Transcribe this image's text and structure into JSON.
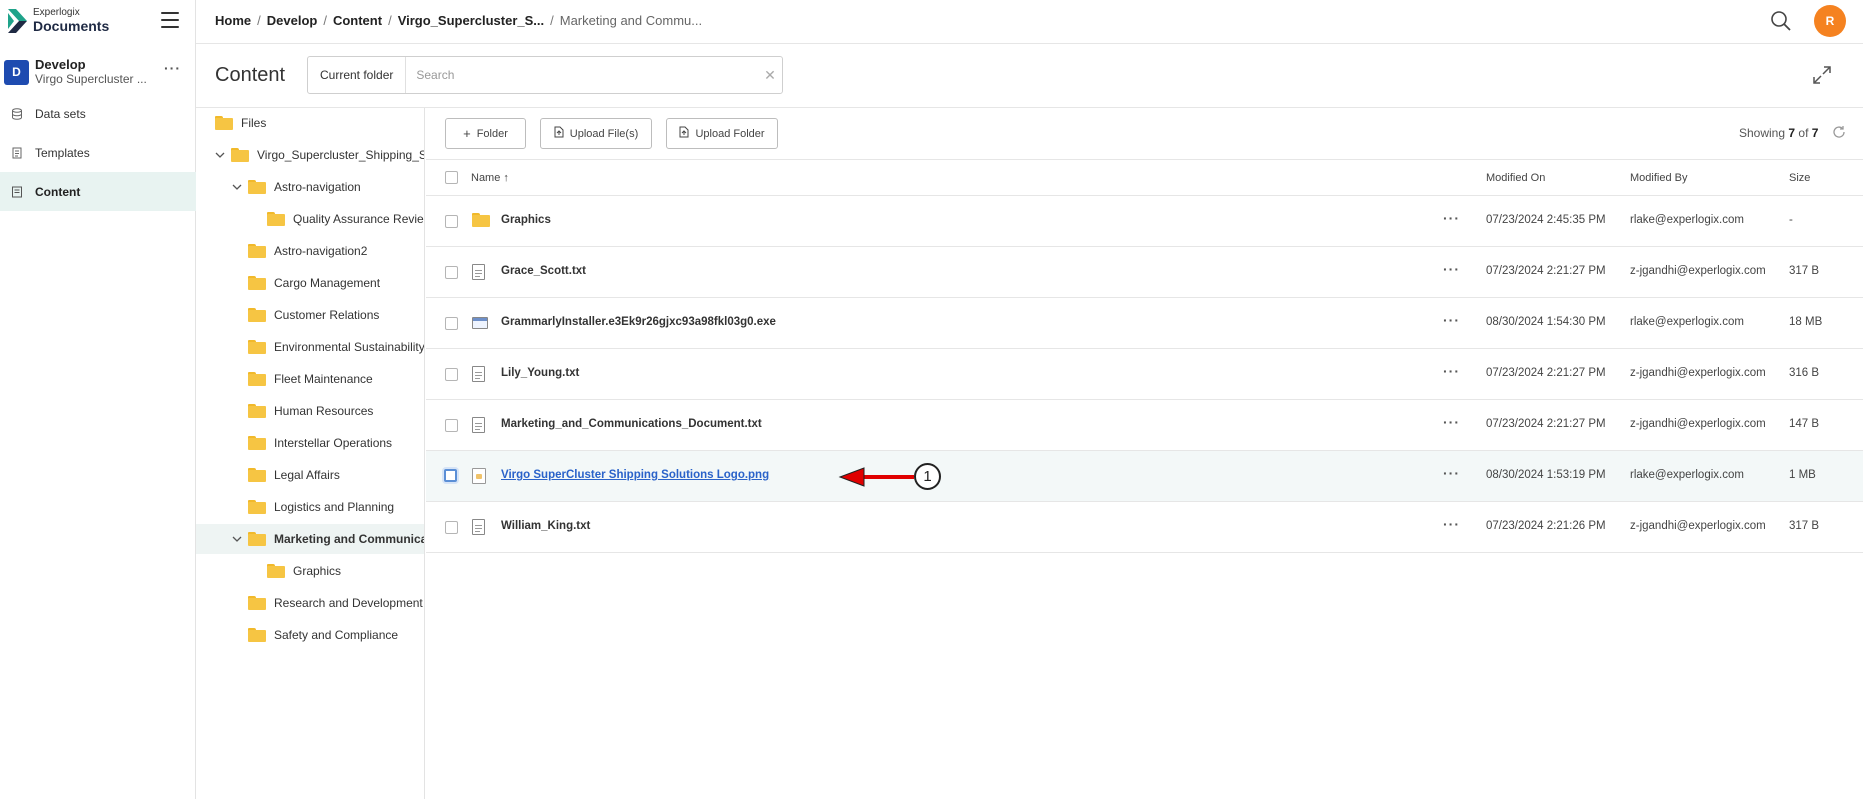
{
  "brand": {
    "small": "Experlogix",
    "big": "Documents"
  },
  "workspace": {
    "initial": "D",
    "title": "Develop",
    "subtitle": "Virgo Supercluster ..."
  },
  "nav": [
    {
      "label": "Data sets",
      "icon": "database-icon"
    },
    {
      "label": "Templates",
      "icon": "template-icon"
    },
    {
      "label": "Content",
      "icon": "content-icon",
      "active": true
    }
  ],
  "breadcrumb": {
    "items": [
      "Home",
      "Develop",
      "Content",
      "Virgo_Supercluster_S..."
    ],
    "current": "Marketing and Commu..."
  },
  "user": {
    "initial": "R",
    "color": "#f58220"
  },
  "content_header": {
    "title": "Content",
    "scope_label": "Current folder",
    "search_placeholder": "Search"
  },
  "tree": [
    {
      "label": "Files",
      "depth": 0,
      "chevron": ""
    },
    {
      "label": "Virgo_Supercluster_Shipping_Sc",
      "depth": 1,
      "chevron": "down"
    },
    {
      "label": "Astro-navigation",
      "depth": 2,
      "chevron": "down"
    },
    {
      "label": "Quality Assurance Revie",
      "depth": 3,
      "chevron": ""
    },
    {
      "label": "Astro-navigation2",
      "depth": 2,
      "chevron": ""
    },
    {
      "label": "Cargo Management",
      "depth": 2,
      "chevron": ""
    },
    {
      "label": "Customer Relations",
      "depth": 2,
      "chevron": ""
    },
    {
      "label": "Environmental Sustainability",
      "depth": 2,
      "chevron": ""
    },
    {
      "label": "Fleet Maintenance",
      "depth": 2,
      "chevron": ""
    },
    {
      "label": "Human Resources",
      "depth": 2,
      "chevron": ""
    },
    {
      "label": "Interstellar Operations",
      "depth": 2,
      "chevron": ""
    },
    {
      "label": "Legal Affairs",
      "depth": 2,
      "chevron": ""
    },
    {
      "label": "Logistics and Planning",
      "depth": 2,
      "chevron": ""
    },
    {
      "label": "Marketing and Communica",
      "depth": 2,
      "chevron": "down",
      "active": true
    },
    {
      "label": "Graphics",
      "depth": 3,
      "chevron": ""
    },
    {
      "label": "Research and Development",
      "depth": 2,
      "chevron": ""
    },
    {
      "label": "Safety and Compliance",
      "depth": 2,
      "chevron": ""
    }
  ],
  "toolbar": {
    "folder_label": "Folder",
    "upload_files_label": "Upload File(s)",
    "upload_folder_label": "Upload Folder",
    "showing_prefix": "Showing",
    "showing_count": "7",
    "showing_of": "of",
    "showing_total": "7"
  },
  "columns": {
    "name": "Name ↑",
    "modified_on": "Modified On",
    "modified_by": "Modified By",
    "size": "Size"
  },
  "rows": [
    {
      "name": "Graphics",
      "type": "folder",
      "modified_on": "07/23/2024 2:45:35 PM",
      "modified_by": "rlake@experlogix.com",
      "size": "-"
    },
    {
      "name": "Grace_Scott.txt",
      "type": "doc",
      "modified_on": "07/23/2024 2:21:27 PM",
      "modified_by": "z-jgandhi@experlogix.com",
      "size": "317 B"
    },
    {
      "name": "GrammarlyInstaller.e3Ek9r26gjxc93a98fkl03g0.exe",
      "type": "exe",
      "modified_on": "08/30/2024 1:54:30 PM",
      "modified_by": "rlake@experlogix.com",
      "size": "18 MB"
    },
    {
      "name": "Lily_Young.txt",
      "type": "doc",
      "modified_on": "07/23/2024 2:21:27 PM",
      "modified_by": "z-jgandhi@experlogix.com",
      "size": "316 B"
    },
    {
      "name": "Marketing_and_Communications_Document.txt",
      "type": "doc",
      "modified_on": "07/23/2024 2:21:27 PM",
      "modified_by": "z-jgandhi@experlogix.com",
      "size": "147 B"
    },
    {
      "name": "Virgo SuperCluster Shipping Solutions Logo.png",
      "type": "image",
      "modified_on": "08/30/2024 1:53:19 PM",
      "modified_by": "rlake@experlogix.com",
      "size": "1 MB",
      "highlighted": true
    },
    {
      "name": "William_King.txt",
      "type": "doc",
      "modified_on": "07/23/2024 2:21:26 PM",
      "modified_by": "z-jgandhi@experlogix.com",
      "size": "317 B"
    }
  ],
  "annotation": {
    "number": "1",
    "color": "#e00000"
  }
}
